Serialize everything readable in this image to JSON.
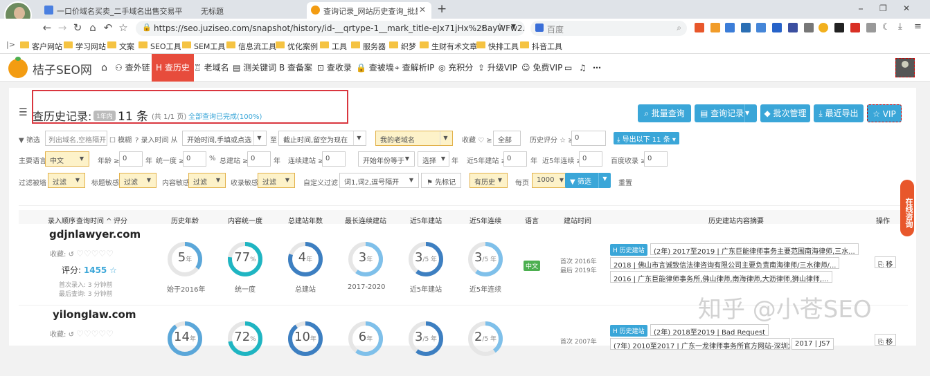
{
  "tabs": [
    {
      "title": "",
      "icon": "avatar"
    },
    {
      "title": "一口价域名买卖_二手域名出售交易平",
      "icon": "page"
    },
    {
      "title": "无标题",
      "icon": "page"
    },
    {
      "title": "查询记录_网站历史查询_批量查询",
      "icon": "orange",
      "active": true
    }
  ],
  "toolbar": {
    "url": "https://seo.juziseo.com/snapshot/history/id-__qrtype-1__mark_title-eJx71jHx%2BayWFw2...",
    "search_placeholder": "百度"
  },
  "bookmarks": [
    "客户网站",
    "学习网站",
    "文案",
    "SEO工具",
    "SEM工具",
    "信息流工具",
    "优化案例",
    "工具",
    "服务器",
    "织梦",
    "生财有术文章",
    "快排工具",
    "抖音工具"
  ],
  "site": {
    "logo": "桔子SEO网",
    "nav": [
      "查外链",
      "查历史",
      "老域名",
      "测关键词",
      "查备案",
      "查收录",
      "查被墙",
      "查解析IP",
      "充积分",
      "升级VIP",
      "免费VIP"
    ],
    "nav_active": "查历史"
  },
  "page": {
    "title": "查历史记录:",
    "badge": "1年内",
    "count": "11 条",
    "pages": "(共 1/1 页)",
    "status": "全部查询已完成(100%)",
    "buttons": [
      "批量查询",
      "查询记录",
      "批次管理",
      "最近导出",
      "VIP"
    ]
  },
  "filters": {
    "row1": {
      "label": "筛选",
      "domain_placeholder": "列出域名,空格隔开",
      "fuzzy": "模糊",
      "time_label": "录入时间 从",
      "start": "开始时间,手填或点选",
      "to": "至",
      "end": "截止时间,留空为现在",
      "old": "我的老域名",
      "fav": "收藏 ♡ ≥",
      "fav_val": "全部",
      "score": "历史评分 ☆ ≥",
      "score_val": "0",
      "export": "导出以下 11 条"
    },
    "row2": {
      "lang_label": "主要语言",
      "lang": "中文",
      "age": "年龄 ≥",
      "age_val": "0",
      "age_unit": "年",
      "unity": "统一度 ≥",
      "unity_val": "0",
      "unity_unit": "%",
      "total": "总建站 ≥",
      "total_val": "0",
      "total_unit": "年",
      "cont": "连续建站 ≥",
      "cont_val": "0",
      "start_year": "开始年份等于",
      "choose": "选择",
      "choose_unit": "年",
      "r5": "近5年建站 ≥",
      "r5_val": "0",
      "r5_unit": "年",
      "r5c": "近5年连续 ≥",
      "r5c_val": "0",
      "baidu": "百度收录 ≥",
      "baidu_val": "0"
    },
    "row3": {
      "wall": "过滤被墙",
      "wall_val": "过滤",
      "title": "标题敏感",
      "title_val": "过滤",
      "content": "内容敏感",
      "content_val": "过滤",
      "index": "收录敏感",
      "index_val": "过滤",
      "custom": "自定义过滤",
      "custom_ph": "词1,词2,逗号隔开",
      "mark": "先标记",
      "hist": "有历史",
      "per": "每页",
      "per_val": "1000",
      "filter": "筛选",
      "reset": "重置"
    }
  },
  "table": {
    "headers": [
      "录入顺序",
      "查询时间",
      "评分",
      "历史年龄",
      "内容统一度",
      "总建站年数",
      "最长连续建站",
      "近5年建站",
      "近5年连续",
      "语言",
      "建站时间",
      "历史建站内容摘要",
      "操作"
    ],
    "rows": [
      {
        "domain": "gdjnlawyer.com",
        "fav": "收藏:",
        "score_label": "评分:",
        "score": "1455",
        "first": "首次录入: 3 分钟前",
        "last": "最后查询: 3 分钟前",
        "rings": [
          {
            "v": "5",
            "u": "年",
            "cap": "始于2016年",
            "pct": 0.35,
            "color": "#5ba7d9"
          },
          {
            "v": "77",
            "u": "%",
            "cap": "统一度",
            "pct": 0.77,
            "color": "#1fb5c2"
          },
          {
            "v": "4",
            "u": "年",
            "cap": "总建站",
            "pct": 0.8,
            "color": "#3d7fc1"
          },
          {
            "v": "3",
            "u": "年",
            "cap": "2017-2020",
            "pct": 0.6,
            "color": "#7fc0ea"
          },
          {
            "v": "3",
            "u": "/5 年",
            "cap": "近5年建站",
            "pct": 0.6,
            "color": "#3d7fc1"
          },
          {
            "v": "3",
            "u": "/5 年",
            "cap": "近5年连续",
            "pct": 0.6,
            "color": "#7fc0ea"
          }
        ],
        "lang": "中文",
        "build1": "首次 2016年",
        "build2": "最后 2019年",
        "hist_tag": "历史建站",
        "hist": [
          "(2年) 2017至2019 | 广东巨能律师事务主要范围南海律师,三水...",
          "2018 | 佛山市言诚致信法律咨询有限公司主要负责南海律师/三水律师/...",
          "2016 | 广东巨能律师事务所,佛山律师,南海律师,大沥律师,狮山律师,..."
        ],
        "op": "移"
      },
      {
        "domain": "yilonglaw.com",
        "fav": "收藏:",
        "rings": [
          {
            "v": "14",
            "u": "年",
            "pct": 0.9,
            "color": "#5ba7d9"
          },
          {
            "v": "72",
            "u": "%",
            "pct": 0.72,
            "color": "#1fb5c2"
          },
          {
            "v": "10",
            "u": "年",
            "pct": 0.9,
            "color": "#3d7fc1"
          },
          {
            "v": "6",
            "u": "年",
            "pct": 0.6,
            "color": "#7fc0ea"
          },
          {
            "v": "3",
            "u": "/5 年",
            "pct": 0.6,
            "color": "#3d7fc1"
          },
          {
            "v": "2",
            "u": "/5 年",
            "pct": 0.4,
            "color": "#7fc0ea"
          }
        ],
        "build1": "首次 2007年",
        "hist_tag": "历史建站",
        "hist": [
          "(2年) 2018至2019 | Bad Request",
          "(7年) 2010至2017 | 广东一龙律师事务所官方网站-深圳龙岗...",
          "2017 | JS7"
        ],
        "op": "移"
      }
    ]
  },
  "side_widget": "在线咨询",
  "watermark": "知乎 @小苍SEO"
}
